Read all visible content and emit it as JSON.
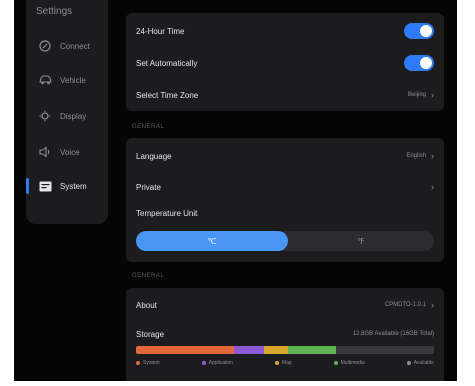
{
  "sidebar": {
    "title": "Settings",
    "items": [
      {
        "label": "Connect",
        "icon": "connect-icon"
      },
      {
        "label": "Vehicle",
        "icon": "car-icon"
      },
      {
        "label": "Display",
        "icon": "brightness-icon"
      },
      {
        "label": "Voice",
        "icon": "speaker-icon"
      },
      {
        "label": "System",
        "icon": "system-icon"
      }
    ],
    "active_index": 4
  },
  "time_card": {
    "hour24_label": "24-Hour Time",
    "hour24_on": true,
    "auto_label": "Set Automatically",
    "auto_on": true,
    "timezone_label": "Select Time Zone",
    "timezone_value": "Beijing"
  },
  "section_general_1": "GENERAL",
  "general_card": {
    "language_label": "Language",
    "language_value": "English",
    "private_label": "Private",
    "temp_label": "Temperature Unit",
    "temp_options": [
      "℃",
      "℉"
    ],
    "temp_selected": 0
  },
  "section_general_2": "GENERAL",
  "about_card": {
    "about_label": "About",
    "about_value": "CPMDTO-1.0.1",
    "storage_label": "Storage",
    "storage_value": "12.8GB Available (16GB Total)",
    "storage_segments": [
      {
        "name": "System",
        "fraction": 0.33,
        "color": "#e2683c"
      },
      {
        "name": "Application",
        "fraction": 0.1,
        "color": "#8e5bd6"
      },
      {
        "name": "Map",
        "fraction": 0.08,
        "color": "#d9a72c"
      },
      {
        "name": "Multimedia",
        "fraction": 0.16,
        "color": "#5fb554"
      },
      {
        "name": "Available",
        "fraction": 0.33,
        "color": "#3a3a3c"
      }
    ]
  },
  "colors": {
    "accent": "#2f7bf5",
    "card": "#1c1c1e",
    "background": "#050505"
  }
}
